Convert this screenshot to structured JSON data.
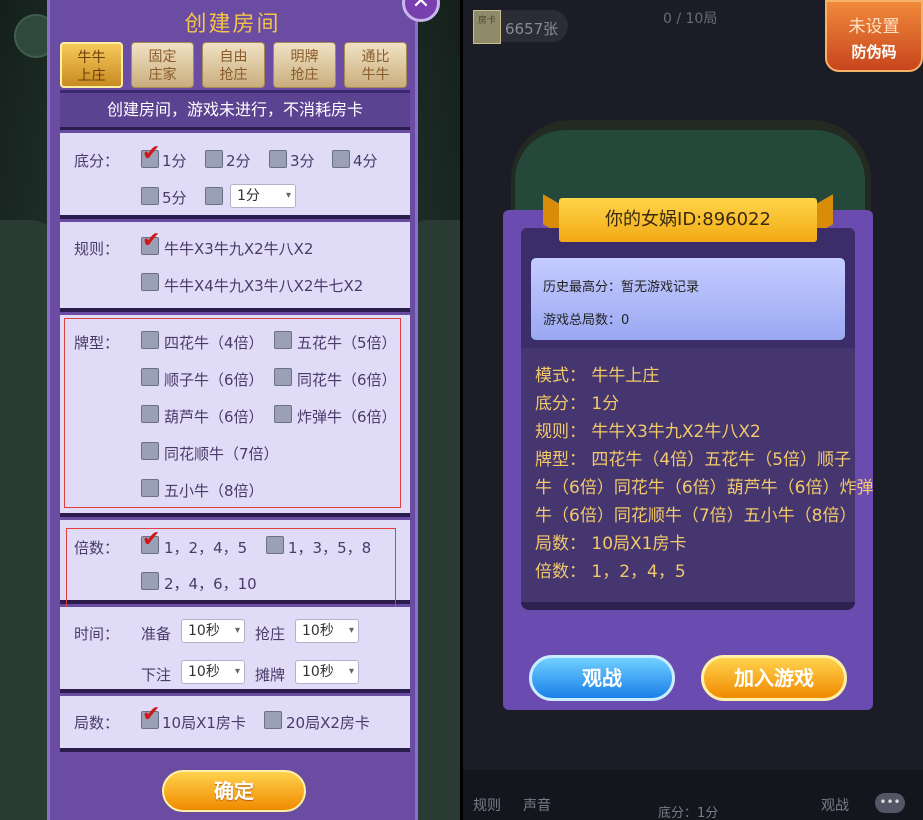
{
  "left": {
    "title": "创建房间",
    "close_icon": "✕",
    "tabs": [
      "牛牛\n上庄",
      "固定\n庄家",
      "自由\n抢庄",
      "明牌\n抢庄",
      "通比\n牛牛"
    ],
    "banner": "创建房间，游戏未进行，不消耗房卡",
    "base_score": {
      "label": "底分：",
      "options": [
        "1分",
        "2分",
        "3分",
        "4分",
        "5分"
      ],
      "select_value": "1分"
    },
    "rules": {
      "label": "规则：",
      "options": [
        "牛牛X3牛九X2牛八X2",
        "牛牛X4牛九X3牛八X2牛七X2"
      ]
    },
    "card_types": {
      "label": "牌型：",
      "options": [
        "四花牛（4倍）",
        "五花牛（5倍）",
        "顺子牛（6倍）",
        "同花牛（6倍）",
        "葫芦牛（6倍）",
        "炸弹牛（6倍）",
        "同花顺牛（7倍）",
        "五小牛（8倍）"
      ]
    },
    "multiplier": {
      "label": "倍数：",
      "options": [
        "1，2，4，5",
        "1，3，5，8",
        "2，4，6，10"
      ]
    },
    "time": {
      "label": "时间：",
      "ready_label": "准备",
      "ready_value": "10秒",
      "grab_label": "抢庄",
      "grab_value": "10秒",
      "bet_label": "下注",
      "bet_value": "10秒",
      "show_label": "摊牌",
      "show_value": "10秒"
    },
    "rounds": {
      "label": "局数：",
      "options": [
        "10局X1房卡",
        "20局X2房卡"
      ]
    },
    "confirm": "确定"
  },
  "right": {
    "room_card_icon": "房卡",
    "cards_count": "6657张",
    "round_progress": "0 / 10局",
    "badge_line1": "未设置",
    "badge_line2": "防伪码",
    "id_title": "你的女娲ID:896022",
    "high_score": "历史最高分：暂无游戏记录",
    "total_games": "游戏总局数：0",
    "info": {
      "mode": "模式：   牛牛上庄",
      "base": "底分：   1分",
      "rule": "规则：   牛牛X3牛九X2牛八X2",
      "types1": "牌型：   四花牛（4倍）五花牛（5倍）顺子",
      "types2": "牛（6倍）同花牛（6倍）葫芦牛（6倍）炸弹",
      "types3": "牛（6倍）同花顺牛（7倍）五小牛（8倍）",
      "rounds": "局数：   10局X1房卡",
      "multi": "倍数：   1，2，4，5"
    },
    "watch_btn": "观战",
    "join_btn": "加入游戏",
    "bottom_rules": "规则",
    "bottom_voice": "声音",
    "bottom_base": "底分：1分",
    "bottom_watch": "观战",
    "chat_icon": "•••"
  }
}
